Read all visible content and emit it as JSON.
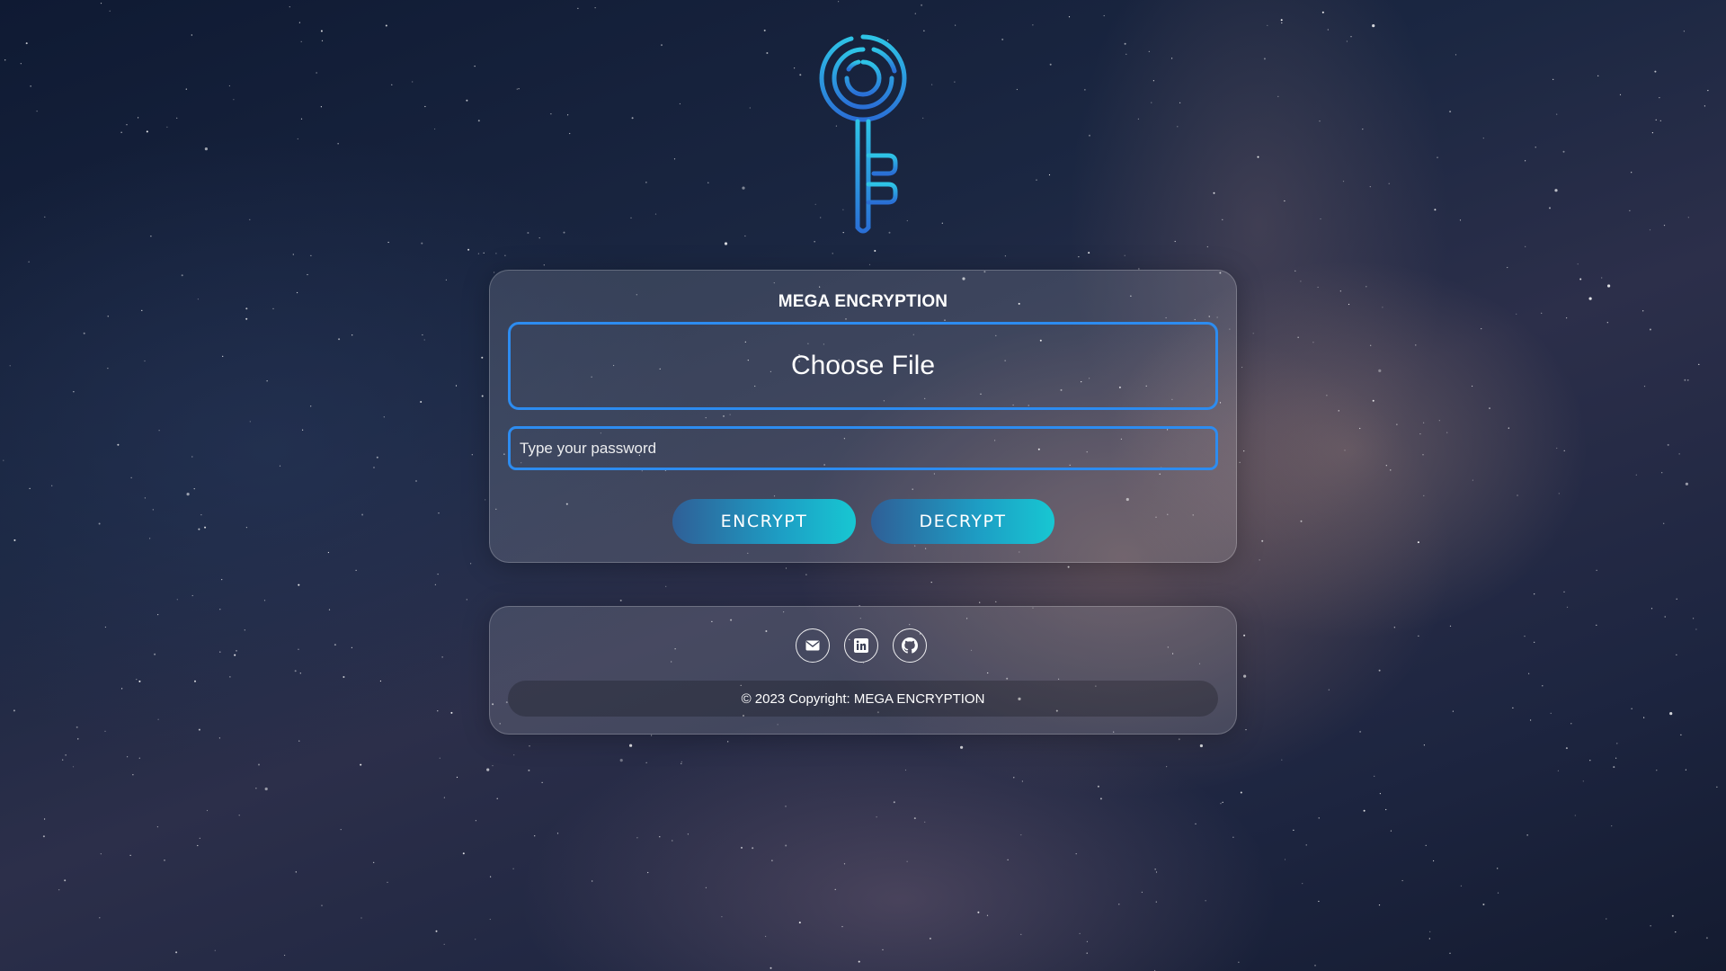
{
  "app": {
    "title": "MEGA ENCRYPTION"
  },
  "logo": {
    "icon": "key-icon",
    "gradient": [
      "#2ec4e6",
      "#2a6fd6"
    ]
  },
  "form": {
    "title": "MEGA ENCRYPTION",
    "file_label": "Choose File",
    "password_placeholder": "Type your password",
    "password_value": "",
    "encrypt_label": "ENCRYPT",
    "decrypt_label": "DECRYPT"
  },
  "footer": {
    "social": [
      {
        "icon": "mail-icon"
      },
      {
        "icon": "linkedin-icon"
      },
      {
        "icon": "github-icon"
      }
    ],
    "copyright": "© 2023 Copyright: MEGA ENCRYPTION"
  },
  "colors": {
    "accent_border": "#2d8cf0",
    "button_gradient": [
      "#2f5f97",
      "#17c7d2"
    ]
  }
}
